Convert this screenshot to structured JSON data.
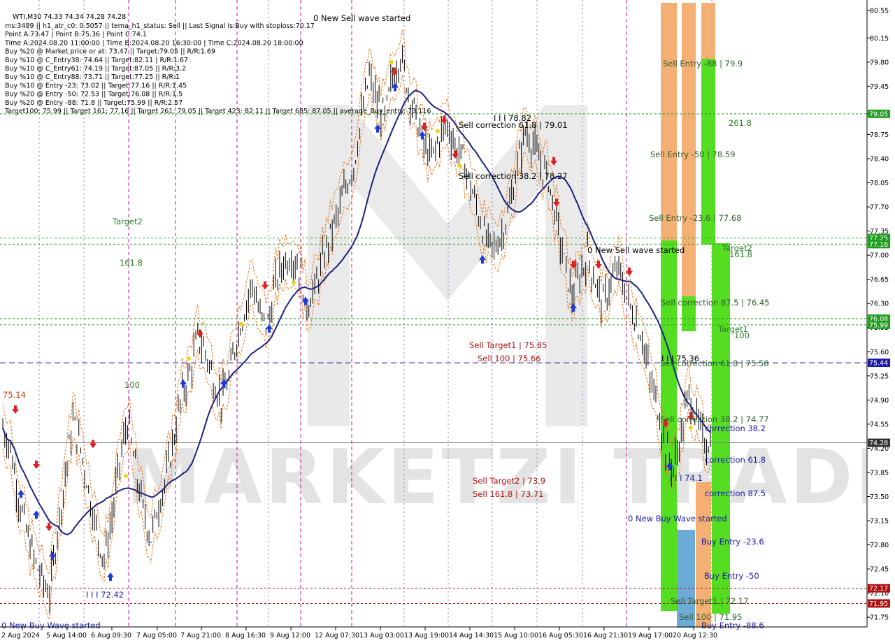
{
  "chart_data": {
    "type": "candlestick",
    "symbol_line": "WTI,M30  74.33 74.34 74.28 74.28",
    "info_lines": [
      "ms:3489 || h1_atr_c0: 0.5057 || tema_h1_status: Sell || Last Signal is:Buy with stoploss:70.17",
      "Point A:73.47 | Point B:75.36 | Point C:74.1",
      "Time A:2024.08.20 11:00:00 | Time B:2024.08.20 16:30:00 | Time C:2024.08.20 18:00:00",
      "Buy %20 @ Market price or at: 73.47 || Target:79.05 || R/R:1.69",
      "Buy %10 @ C_Entry38: 74.64 || Target:82.11 | R/R:1.67",
      "Buy %10 @ C_Entry61: 74.19 || Target:87.05 || R/R:3.2",
      "Buy %10 @ C_Entry88: 73.71 || Target:77.25 || R/R:1",
      "Buy %10 @ Entry -23: 73.02 || Target:77.16 || R/R:1.45",
      "Buy %20 @ Entry -50: 72.53 || Target:76.08 || R/R:1.5",
      "Buy %20 @ Entry -88: 71.8 || Target:75.99 || R/R:2.57",
      "Target100: 75.99 || Target 161: 77.16 || Target 261: 79.05 || Target 423: 82.11 || Target 685: 87.05 || average_Buy_entry: 73.116"
    ],
    "ylim": [
      71.62,
      80.66
    ],
    "y_ticks": [
      "80.55",
      "80.15",
      "79.80",
      "79.45",
      "79.05",
      "78.75",
      "78.40",
      "78.05",
      "77.70",
      "77.35",
      "77.00",
      "76.65",
      "76.30",
      "75.95",
      "75.60",
      "75.25",
      "74.90",
      "74.55",
      "74.20",
      "73.85",
      "73.50",
      "73.15",
      "72.80",
      "72.45",
      "72.10",
      "71.75"
    ],
    "x_labels": [
      "2 Aug 2024",
      "5 Aug 14:00",
      "6 Aug 09:30",
      "7 Aug 05:00",
      "7 Aug 21:00",
      "8 Aug 16:30",
      "9 Aug 12:00",
      "12 Aug 07:30",
      "13 Aug 03:00",
      "13 Aug 19:00",
      "14 Aug 14:30",
      "15 Aug 10:00",
      "16 Aug 05:30",
      "16 Aug 21:30",
      "19 Aug 17:00",
      "20 Aug 12:30"
    ],
    "price_path": [
      74.5,
      74.2,
      73.5,
      73.0,
      72.6,
      72.3,
      72.1,
      73.0,
      73.8,
      74.6,
      74.2,
      73.6,
      73.0,
      72.6,
      73.2,
      74.0,
      74.6,
      73.9,
      73.3,
      72.9,
      73.4,
      73.8,
      74.4,
      75.0,
      75.3,
      75.8,
      75.6,
      75.2,
      74.9,
      75.2,
      75.8,
      76.2,
      76.6,
      76.1,
      76.0,
      76.6,
      76.9,
      77.0,
      76.8,
      76.3,
      76.5,
      76.9,
      77.3,
      77.6,
      78.0,
      78.3,
      79.0,
      79.6,
      79.2,
      79.0,
      79.6,
      79.9,
      79.4,
      79.0,
      78.6,
      78.4,
      78.7,
      78.9,
      78.6,
      78.4,
      78.0,
      77.6,
      77.2,
      77.1,
      77.3,
      77.7,
      78.3,
      78.8,
      78.6,
      78.3,
      78.1,
      77.5,
      76.9,
      76.4,
      76.7,
      77.0,
      76.6,
      76.3,
      76.6,
      76.8,
      76.4,
      76.1,
      75.8,
      75.2,
      74.8,
      74.2,
      73.9,
      74.4,
      75.0,
      74.6,
      74.3,
      74.28
    ],
    "current_price": "74.28",
    "right_tags": [
      {
        "v": 79.05,
        "label": "79.05",
        "color": "#1f9e1f"
      },
      {
        "v": 77.25,
        "label": "77.25",
        "color": "#1f9e1f"
      },
      {
        "v": 77.16,
        "label": "77.16",
        "color": "#1f9e1f"
      },
      {
        "v": 76.08,
        "label": "76.08",
        "color": "#1f9e1f"
      },
      {
        "v": 75.99,
        "label": "75.99",
        "color": "#1f9e1f"
      },
      {
        "v": 75.44,
        "label": "75.44",
        "color": "#1a1aa8"
      },
      {
        "v": 74.28,
        "label": "74.28",
        "color": "#333333"
      },
      {
        "v": 72.17,
        "label": "72.17",
        "color": "#b01010"
      },
      {
        "v": 71.95,
        "label": "71.95",
        "color": "#b01010"
      }
    ],
    "annotations": [
      {
        "text": "0 New Sell wave started",
        "color": "#000000"
      },
      {
        "text": "0 New Sell wave started",
        "color": "#000000"
      },
      {
        "text": "0 New Buy Wave started",
        "color": "#1a1aa8"
      },
      {
        "text": "0 New Buy Wave started",
        "color": "#1a1aa8"
      },
      {
        "text": "Target2",
        "color": "#2e7d2e"
      },
      {
        "text": "161.8",
        "color": "#2e7d2e"
      },
      {
        "text": "100",
        "color": "#2e7d2e"
      },
      {
        "text": "75.14",
        "color": "#cc3300"
      },
      {
        "text": "I I I 72.42",
        "color": "#1a1aa8"
      },
      {
        "text": "I I I 78.82",
        "color": "#000000"
      },
      {
        "text": "Sell correction 61.8 | 79.01",
        "color": "#000000"
      },
      {
        "text": "Sell correction 38.2 | 78.27",
        "color": "#000000"
      },
      {
        "text": "Sell Target1 | 75.85",
        "color": "#b01010"
      },
      {
        "text": "Sell 100 | 75.66",
        "color": "#b01010"
      },
      {
        "text": "Sell Target2 | 73.9",
        "color": "#b01010"
      },
      {
        "text": "Sell 161.8 | 73.71",
        "color": "#b01010"
      },
      {
        "text": "Sell Entry -88 | 79.9",
        "color": "#2e5e2e"
      },
      {
        "text": "261.8",
        "color": "#2e7d2e"
      },
      {
        "text": "Sell Entry -50 | 78.59",
        "color": "#2e5e2e"
      },
      {
        "text": "Sell Entry -23.6 | 77.68",
        "color": "#2e5e2e"
      },
      {
        "text": "Target2",
        "color": "#2e7d2e"
      },
      {
        "text": "161.8",
        "color": "#2e7d2e"
      },
      {
        "text": "Sell correction 87.5 | 76.45",
        "color": "#2e5e2e"
      },
      {
        "text": "Target1",
        "color": "#2e7d2e"
      },
      {
        "text": "100",
        "color": "#2e7d2e"
      },
      {
        "text": "I I I 75.36",
        "color": "#000000"
      },
      {
        "text": "Sell correction 61.8 | 75.58",
        "color": "#2e5e2e"
      },
      {
        "text": "Sell correction 38.2 | 74.77",
        "color": "#2e5e2e"
      },
      {
        "text": "correction 38.2",
        "color": "#1a1aa8"
      },
      {
        "text": "correction 61.8",
        "color": "#1a1aa8"
      },
      {
        "text": "I I I 74.1",
        "color": "#1a1aa8"
      },
      {
        "text": "correction 87.5",
        "color": "#1a1aa8"
      },
      {
        "text": "Buy Entry -23.6",
        "color": "#1a1aa8"
      },
      {
        "text": "Buy Entry -50",
        "color": "#1a1aa8"
      },
      {
        "text": "Sell Target1 | 72.17",
        "color": "#2e5e2e"
      },
      {
        "text": "Sell 100 | 71.95",
        "color": "#2e5e2e"
      },
      {
        "text": "Buy Entry -88.6",
        "color": "#1a1aa8"
      }
    ],
    "watermark": "MARKETZI TRADE"
  }
}
